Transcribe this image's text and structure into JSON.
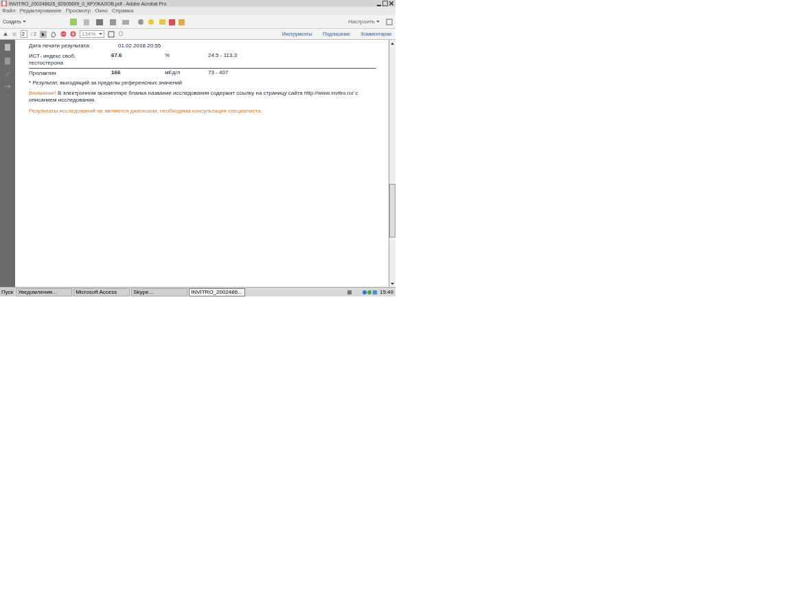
{
  "window": {
    "title": "INVITRO_200248626_82605699_0_КРУЖАЛОВ.pdf - Adobe Acrobat Pro"
  },
  "menu": [
    "Файл",
    "Редактирование",
    "Просмотр",
    "Окно",
    "Справка"
  ],
  "toolbar": {
    "create_button": "Создать",
    "customize": "Настроить"
  },
  "navigation": {
    "page": "2",
    "total": "/ 2",
    "zoom": "134%"
  },
  "panes": [
    {
      "label": "Инструменты"
    },
    {
      "label": "Подписание"
    },
    {
      "label": "Комментарии"
    }
  ],
  "document": {
    "print_date": {
      "label": "Дата печати результата:",
      "value": "01.02.2018 20:55"
    },
    "rows": [
      {
        "name": "ИСТ- индекс своб. тестостерона",
        "value": "67.6",
        "unit": "%",
        "range": "24.5 - 113.3"
      },
      {
        "name": "Пролактин",
        "value": "166",
        "unit": "мЕд/л",
        "range": "73 - 407"
      }
    ],
    "footnote": "* Результат, выходящий за пределы референсных значений",
    "notice": {
      "lead": "Внимание!",
      "text": "В электронном экземпляре бланка название исследования содержит ссылку на страницу сайта",
      "link": "http://www.invitro.ru/",
      "tail": "с описанием исследования."
    },
    "disclaimer": "Результаты исследований не являются диагнозом, необходима консультация специалиста."
  },
  "taskbar": {
    "start": "Пуск",
    "tasks": [
      {
        "label": "Уведомления...",
        "selected": false
      },
      {
        "label": "Microsoft Access",
        "selected": false
      },
      {
        "label": "Skype...",
        "selected": false
      },
      {
        "label": "INVITRO_2002486...",
        "selected": true
      }
    ],
    "clock": "15:49"
  }
}
